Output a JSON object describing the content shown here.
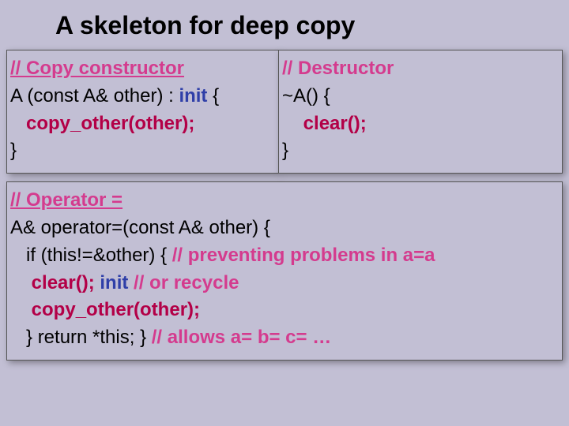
{
  "title": "A skeleton for deep copy",
  "copyctor": {
    "c1": "// Copy constructor",
    "l2a": "A (const A& other) : ",
    "l2b": "init",
    "l2c": " {",
    "l3": "copy_other(other);",
    "l4": "}"
  },
  "dtor": {
    "c1": "// Destructor",
    "l2": "~A() {",
    "l3": "clear();",
    "l4": "}"
  },
  "op": {
    "c1": "// Operator =",
    "l2": "A& operator=(const A& other) {",
    "l3a": "   if (this!=&other) { ",
    "l3b": "// preventing problems in a=a",
    "l4a": "clear();",
    "l4b": " ",
    "l4c": "init",
    "l4d": " ",
    "l4e": "// or recycle",
    "l5": "copy_other(other);",
    "l6a": "   } return *this; } ",
    "l6b": "// allows a= b= c= …"
  }
}
